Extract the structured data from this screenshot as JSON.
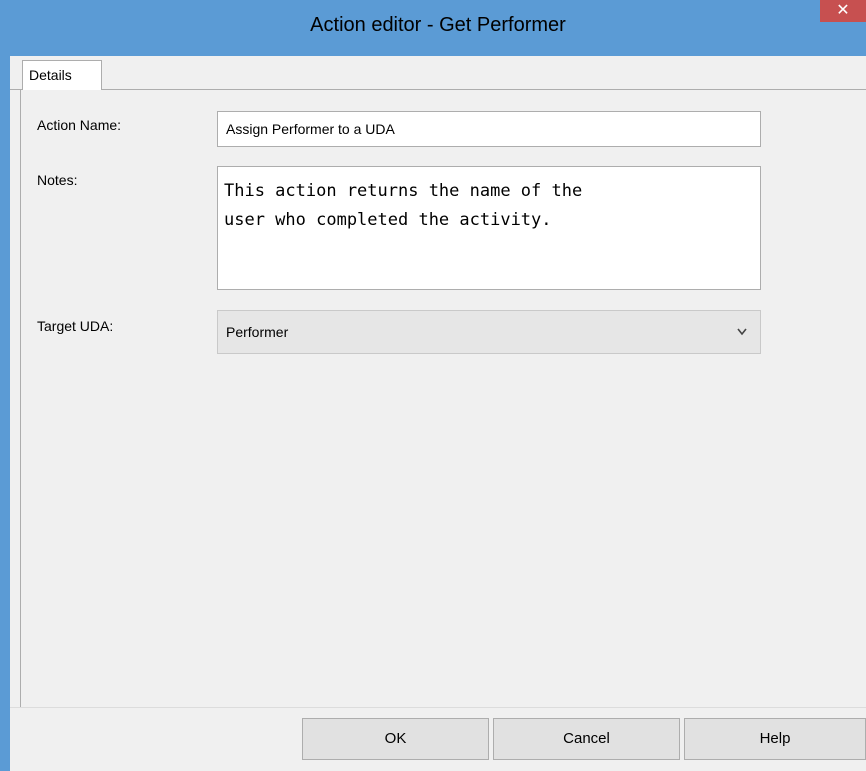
{
  "window": {
    "title": "Action editor - Get Performer",
    "close_glyph": "✕"
  },
  "tabs": [
    {
      "label": "Details",
      "selected": true
    }
  ],
  "form": {
    "action_name": {
      "label": "Action Name:",
      "value": "Assign Performer to a UDA"
    },
    "notes": {
      "label": "Notes:",
      "value": "This action returns the name of the\nuser who completed the activity."
    },
    "target_uda": {
      "label": "Target UDA:",
      "value": "Performer"
    }
  },
  "buttons": {
    "ok": "OK",
    "cancel": "Cancel",
    "help": "Help"
  },
  "colors": {
    "titlebar": "#5b9bd5",
    "close_button": "#c75050",
    "background": "#f0f0f0"
  }
}
